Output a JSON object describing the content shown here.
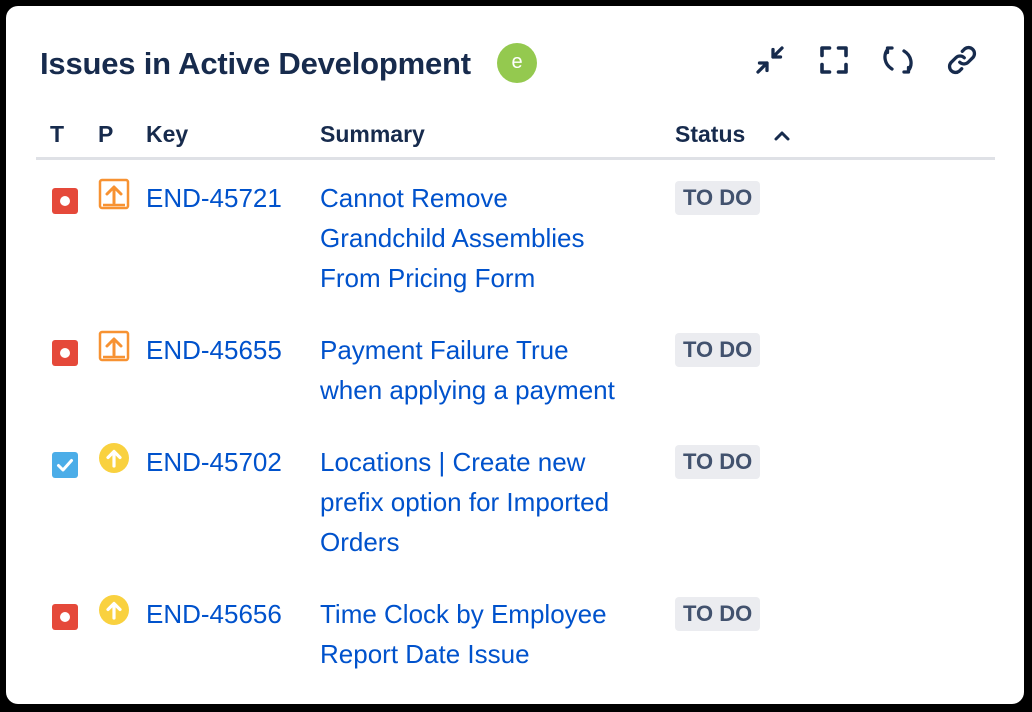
{
  "gadget": {
    "title": "Issues in Active Development",
    "avatar_letter": "e",
    "toolbar": {
      "minimize_icon": "minimize-icon",
      "fullscreen_icon": "fullscreen-icon",
      "refresh_icon": "refresh-icon",
      "link_icon": "link-icon"
    }
  },
  "columns": {
    "type": "T",
    "priority": "P",
    "key": "Key",
    "summary": "Summary",
    "status": "Status",
    "sort": "ascending"
  },
  "colors": {
    "link": "#0052cc",
    "bug": "#e5493a",
    "task": "#4bade8",
    "priority_high": "#f79232",
    "priority_medium": "#f9d13f"
  },
  "issues": [
    {
      "type": "bug",
      "type_icon": "bug-icon",
      "priority_icon": "priority-high-icon",
      "key": "END-45721",
      "summary": "Cannot Remove Grandchild Assemblies From Pricing Form",
      "summary_lines": [
        "Cannot Remove",
        "Grandchild Assemblies",
        "From Pricing Form"
      ],
      "status": "TO DO"
    },
    {
      "type": "bug",
      "type_icon": "bug-icon",
      "priority_icon": "priority-high-icon",
      "key": "END-45655",
      "summary": "Payment Failure True when applying a payment",
      "summary_lines": [
        "Payment Failure True",
        "when applying a payment"
      ],
      "status": "TO DO"
    },
    {
      "type": "task",
      "type_icon": "task-icon",
      "priority_icon": "priority-medium-icon",
      "key": "END-45702",
      "summary": "Locations | Create new prefix option for Imported Orders",
      "summary_lines": [
        "Locations | Create new",
        "prefix option for Imported",
        "Orders"
      ],
      "status": "TO DO"
    },
    {
      "type": "bug",
      "type_icon": "bug-icon",
      "priority_icon": "priority-medium-icon",
      "key": "END-45656",
      "summary": "Time Clock by Employee Report Date Issue",
      "summary_lines": [
        "Time Clock by Employee",
        "Report Date Issue"
      ],
      "status": "TO DO"
    }
  ]
}
